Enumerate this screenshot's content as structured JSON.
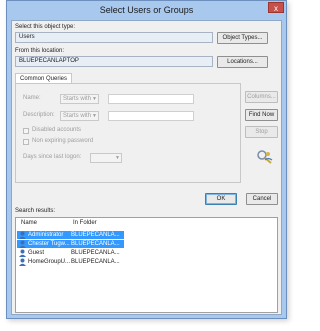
{
  "window": {
    "title": "Select Users or Groups",
    "close_glyph": "x"
  },
  "object_type": {
    "label": "Select this object type:",
    "value": "Users",
    "button": "Object Types..."
  },
  "location": {
    "label": "From this location:",
    "value": "BLUEPECANLAPTOP",
    "button": "Locations..."
  },
  "queries": {
    "tab_label": "Common Queries",
    "name_label": "Name:",
    "name_mode": "Starts with",
    "description_label": "Description:",
    "description_mode": "Starts with",
    "disabled_accounts": "Disabled accounts",
    "non_expiring": "Non expiring password",
    "days_label": "Days since last logon:",
    "columns_button": "Columns...",
    "find_now_button": "Find Now",
    "stop_button": "Stop"
  },
  "actions": {
    "ok": "OK",
    "cancel": "Cancel"
  },
  "results": {
    "label": "Search results:",
    "columns": [
      "Name",
      "In Folder"
    ],
    "rows": [
      {
        "name": "Administrator",
        "folder": "BLUEPECANLA...",
        "selected": true
      },
      {
        "name": "Chester Tugw...",
        "folder": "BLUEPECANLA...",
        "selected": true
      },
      {
        "name": "Guest",
        "folder": "BLUEPECANLA...",
        "selected": false
      },
      {
        "name": "HomeGroupU...",
        "folder": "BLUEPECANLA...",
        "selected": false
      }
    ]
  },
  "colors": {
    "selection": "#3399ff",
    "frame": "#a9c8ee",
    "close": "#c7504b"
  }
}
